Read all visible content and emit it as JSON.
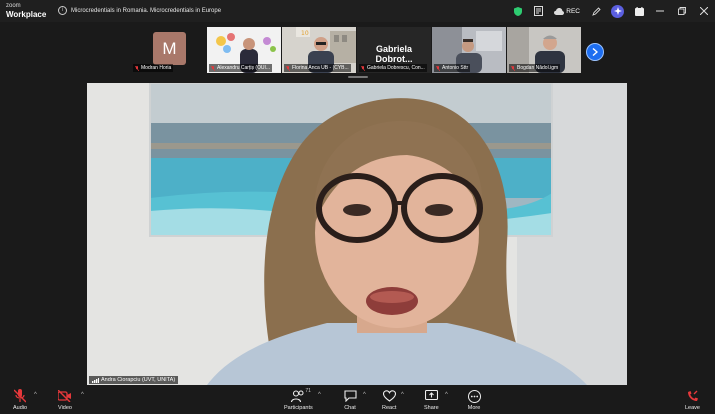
{
  "app": {
    "brand_line1": "zoom",
    "brand_line2": "Workplace",
    "meeting_title": "Microcredentials in Romania. Microcredentials in Europe",
    "rec_label": "REC"
  },
  "thumbnails": [
    {
      "name": "Modran Horia",
      "initial": "M",
      "avatar_color": "#a9786a"
    },
    {
      "name": "Alexandru Carțiș (OUI...",
      "type": "video"
    },
    {
      "name": "Florina Anca UB - (CYB...",
      "type": "video"
    },
    {
      "name": "Gabriela Dobrot...",
      "big_name": "Gabriela Dobrot...",
      "caption": "Gabriela Dobrescu, Con...",
      "type": "name"
    },
    {
      "name": "Antonio Sttr",
      "type": "video"
    },
    {
      "name": "Bogdan Nădol.igm",
      "type": "video"
    }
  ],
  "main": {
    "speaker_name": "Andra Ciorapciu (UVT, UNITA)"
  },
  "toolbar": {
    "audio": "Audio",
    "video": "Video",
    "participants": "Participants",
    "participants_count": "71",
    "chat": "Chat",
    "react": "React",
    "share": "Share",
    "more": "More",
    "leave": "Leave"
  },
  "colors": {
    "accent_blue": "#1e6ef0",
    "ai_purple": "#5b5fe0",
    "muted_red": "#e5383b",
    "shield_green": "#2ecc71"
  }
}
